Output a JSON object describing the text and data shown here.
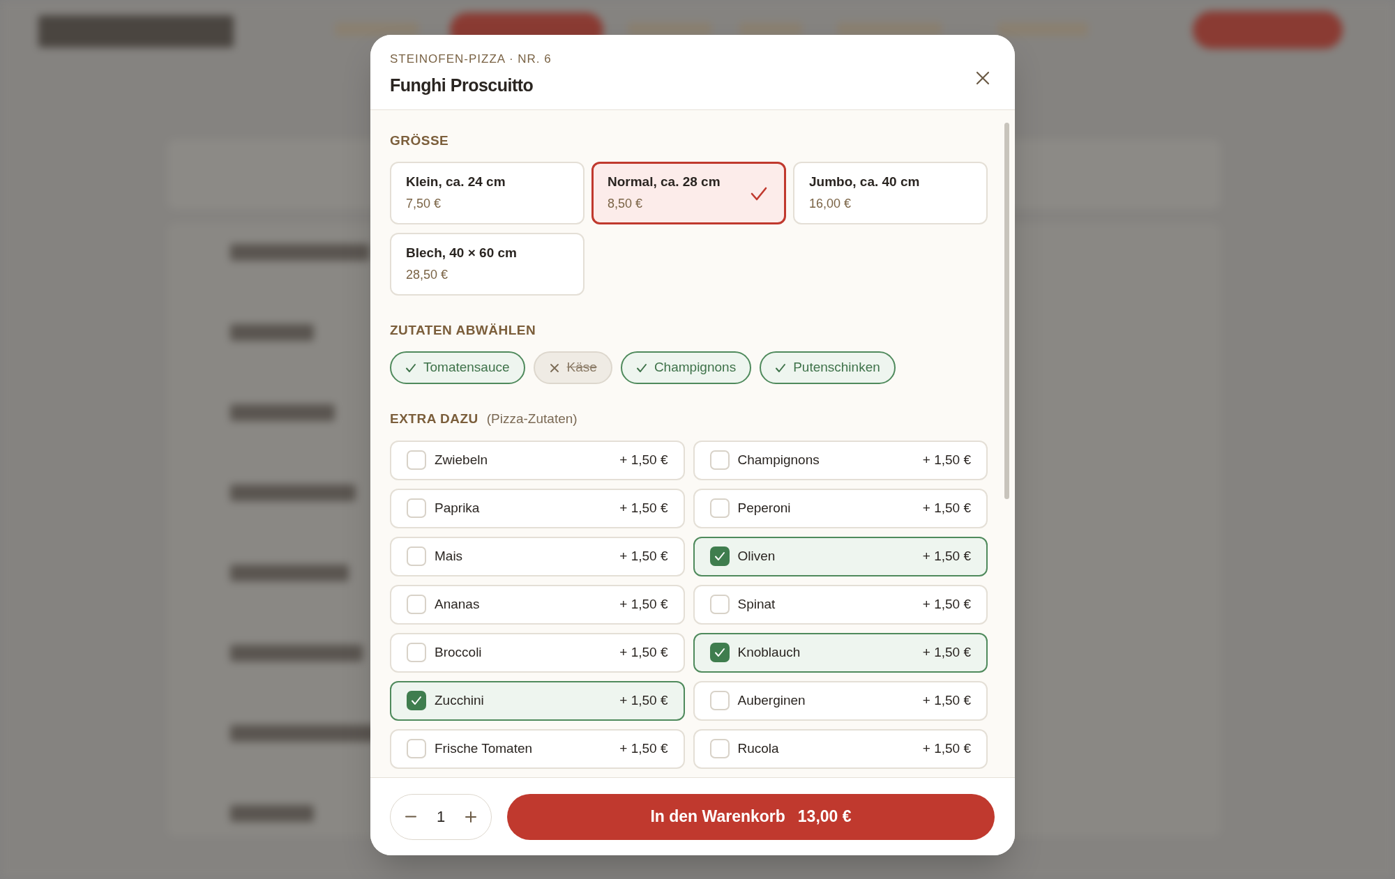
{
  "dialog": {
    "eyebrow": "STEINOFEN-PIZZA · NR. 6",
    "title": "Funghi Proscuitto"
  },
  "size": {
    "heading": "GRÖSSE",
    "options": [
      {
        "label": "Klein, ca. 24 cm",
        "price": "7,50 €",
        "selected": false
      },
      {
        "label": "Normal, ca. 28 cm",
        "price": "8,50 €",
        "selected": true
      },
      {
        "label": "Jumbo, ca. 40 cm",
        "price": "16,00 €",
        "selected": false
      },
      {
        "label": "Blech, 40 × 60 cm",
        "price": "28,50 €",
        "selected": false
      }
    ]
  },
  "ingredients": {
    "heading": "ZUTATEN ABWÄHLEN",
    "items": [
      {
        "label": "Tomatensauce",
        "included": true
      },
      {
        "label": "Käse",
        "included": false
      },
      {
        "label": "Champignons",
        "included": true
      },
      {
        "label": "Putenschinken",
        "included": true
      }
    ]
  },
  "extras": {
    "heading": "EXTRA DAZU",
    "note": "(Pizza-Zutaten)",
    "items": [
      {
        "label": "Zwiebeln",
        "price": "+ 1,50 €",
        "checked": false
      },
      {
        "label": "Champignons",
        "price": "+ 1,50 €",
        "checked": false
      },
      {
        "label": "Paprika",
        "price": "+ 1,50 €",
        "checked": false
      },
      {
        "label": "Peperoni",
        "price": "+ 1,50 €",
        "checked": false
      },
      {
        "label": "Mais",
        "price": "+ 1,50 €",
        "checked": false
      },
      {
        "label": "Oliven",
        "price": "+ 1,50 €",
        "checked": true
      },
      {
        "label": "Ananas",
        "price": "+ 1,50 €",
        "checked": false
      },
      {
        "label": "Spinat",
        "price": "+ 1,50 €",
        "checked": false
      },
      {
        "label": "Broccoli",
        "price": "+ 1,50 €",
        "checked": false
      },
      {
        "label": "Knoblauch",
        "price": "+ 1,50 €",
        "checked": true
      },
      {
        "label": "Zucchini",
        "price": "+ 1,50 €",
        "checked": true
      },
      {
        "label": "Auberginen",
        "price": "+ 1,50 €",
        "checked": false
      },
      {
        "label": "Frische Tomaten",
        "price": "+ 1,50 €",
        "checked": false
      },
      {
        "label": "Rucola",
        "price": "+ 1,50 €",
        "checked": false
      }
    ]
  },
  "footer": {
    "quantity": "1",
    "button_label": "In den Warenkorb",
    "button_price": "13,00 €"
  }
}
